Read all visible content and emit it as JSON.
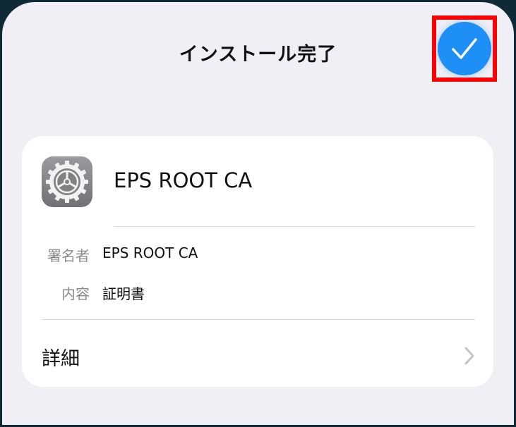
{
  "header": {
    "title": "インストール完了",
    "done_icon": "checkmark-icon",
    "accent_color": "#1f8ff8",
    "highlight_color": "#ff0000"
  },
  "profile": {
    "icon": "settings-gear-icon",
    "name": "EPS ROOT CA",
    "fields": [
      {
        "label": "署名者",
        "value": "EPS ROOT CA"
      },
      {
        "label": "内容",
        "value": "証明書"
      }
    ],
    "details_label": "詳細",
    "details_icon": "chevron-right-icon"
  }
}
